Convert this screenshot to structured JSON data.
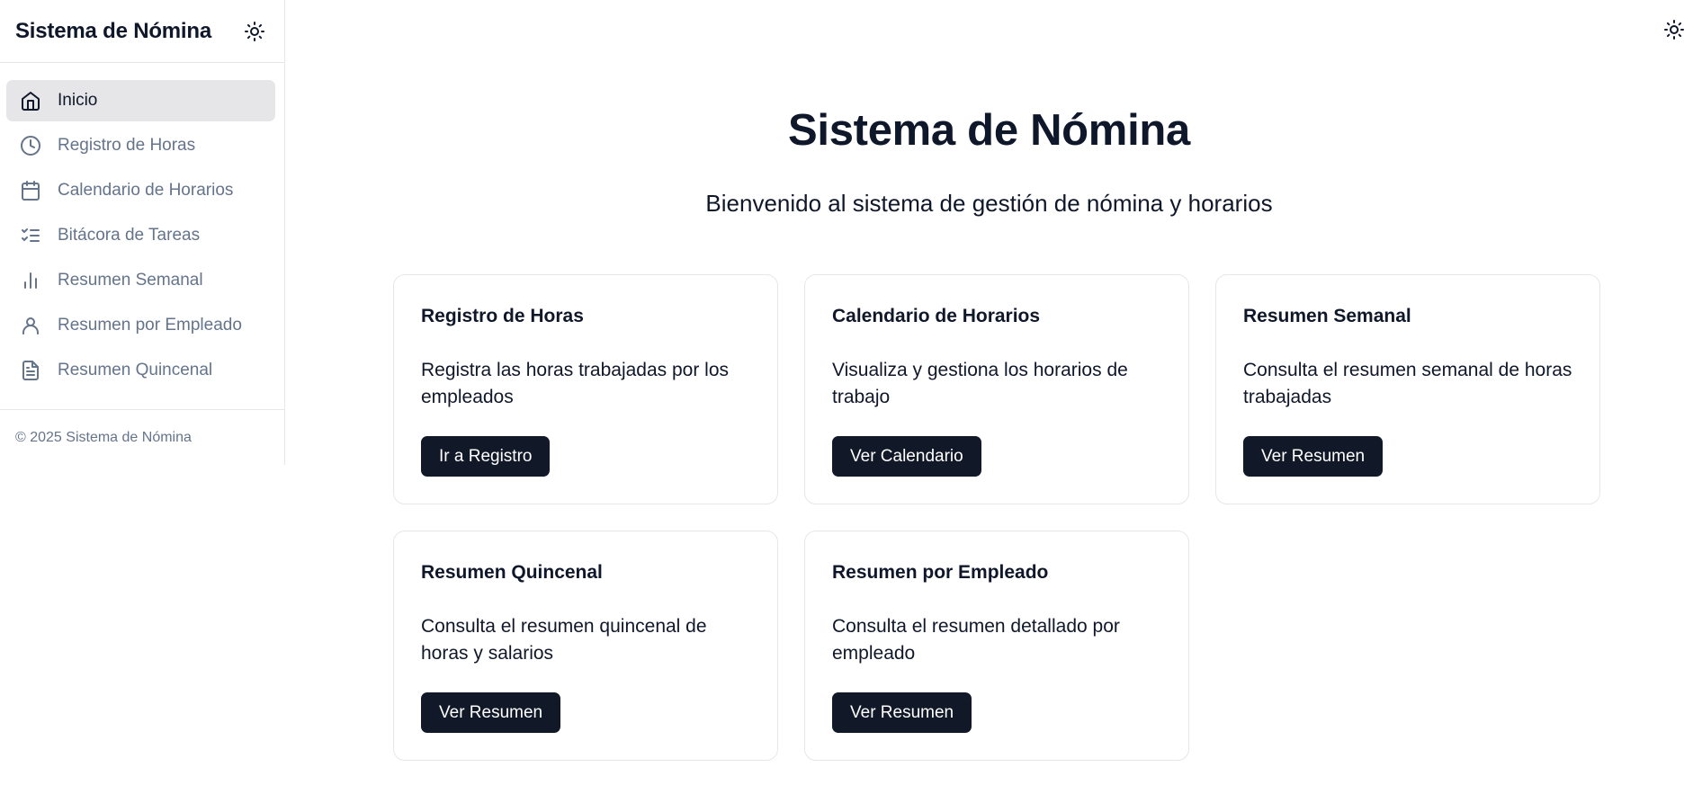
{
  "app": {
    "title": "Sistema de Nómina"
  },
  "sidebar": {
    "items": [
      {
        "label": "Inicio",
        "icon": "home-icon",
        "active": true
      },
      {
        "label": "Registro de Horas",
        "icon": "clock-icon",
        "active": false
      },
      {
        "label": "Calendario de Horarios",
        "icon": "calendar-icon",
        "active": false
      },
      {
        "label": "Bitácora de Tareas",
        "icon": "list-checks-icon",
        "active": false
      },
      {
        "label": "Resumen Semanal",
        "icon": "bar-chart-icon",
        "active": false
      },
      {
        "label": "Resumen por Empleado",
        "icon": "user-icon",
        "active": false
      },
      {
        "label": "Resumen Quincenal",
        "icon": "file-text-icon",
        "active": false
      }
    ],
    "footer": "© 2025 Sistema de Nómina"
  },
  "main": {
    "title": "Sistema de Nómina",
    "subtitle": "Bienvenido al sistema de gestión de nómina y horarios",
    "cards": [
      {
        "title": "Registro de Horas",
        "description": "Registra las horas trabajadas por los empleados",
        "button": "Ir a Registro"
      },
      {
        "title": "Calendario de Horarios",
        "description": "Visualiza y gestiona los horarios de trabajo",
        "button": "Ver Calendario"
      },
      {
        "title": "Resumen Semanal",
        "description": "Consulta el resumen semanal de horas trabajadas",
        "button": "Ver Resumen"
      },
      {
        "title": "Resumen Quincenal",
        "description": "Consulta el resumen quincenal de horas y salarios",
        "button": "Ver Resumen"
      },
      {
        "title": "Resumen por Empleado",
        "description": "Consulta el resumen detallado por empleado",
        "button": "Ver Resumen"
      }
    ]
  },
  "colors": {
    "primary": "#111827",
    "text": "#0f172a",
    "muted": "#64748b",
    "active_bg": "#e6e6e9",
    "border": "#e5e7eb"
  },
  "icons": {
    "theme_toggle": "sun-icon"
  }
}
